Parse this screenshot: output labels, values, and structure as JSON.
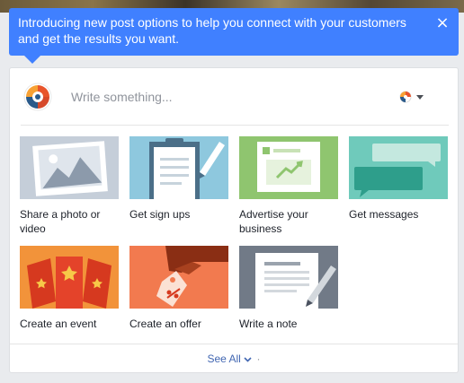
{
  "tooltip": {
    "text": "Introducing new post options to help you connect with your customers and get the results you want.",
    "close_glyph": "×",
    "color": "#4080ff"
  },
  "composer": {
    "placeholder": "Write something...",
    "avatar_icon": "profile-avatar-icon",
    "audience_icon": "audience-selector-icon"
  },
  "options": [
    {
      "label": "Share a photo or video",
      "icon": "photo-icon"
    },
    {
      "label": "Get sign ups",
      "icon": "sign-up-clipboard-icon"
    },
    {
      "label": "Advertise your business",
      "icon": "advertise-icon"
    },
    {
      "label": "Get messages",
      "icon": "messages-icon"
    },
    {
      "label": "Create an event",
      "icon": "event-tickets-icon"
    },
    {
      "label": "Create an offer",
      "icon": "offer-tag-icon"
    },
    {
      "label": "Write a note",
      "icon": "note-icon"
    }
  ],
  "footer": {
    "see_all_label": "See All",
    "separator": "·"
  }
}
